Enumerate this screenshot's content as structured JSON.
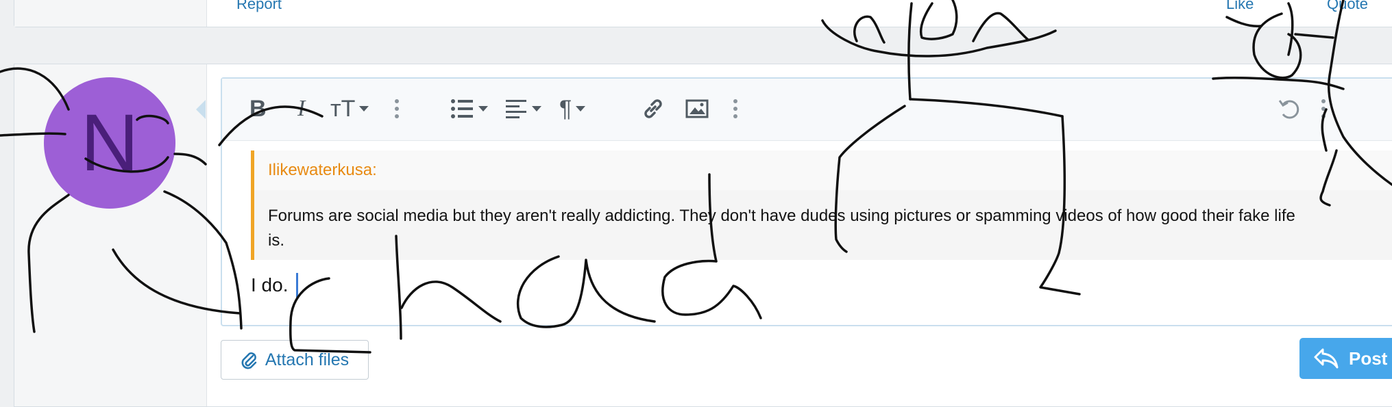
{
  "prev_post": {
    "report_label": "Report",
    "like_label": "Like",
    "quote_label": "Quote"
  },
  "avatar": {
    "letter": "N",
    "color": "#9d5fd6"
  },
  "toolbar": {
    "bold_glyph": "B",
    "italic_glyph": "I",
    "text_size_glyph": "тT",
    "paragraph_glyph": "¶"
  },
  "quote": {
    "author": "Ilikewaterkusa:",
    "line1": "Forums are social media but they aren't really addicting. They don't have dudes using pictures or spamming videos of how good their fake life",
    "line2": "is."
  },
  "editor": {
    "text": "I do."
  },
  "buttons": {
    "attach_label": "Attach files",
    "post_label": "Post"
  },
  "scribble": {
    "word": "chad",
    "color": "#111111"
  },
  "colors": {
    "accent": "#2577b1",
    "quote_bar": "#f0a526",
    "post_button": "#47a7eb"
  }
}
